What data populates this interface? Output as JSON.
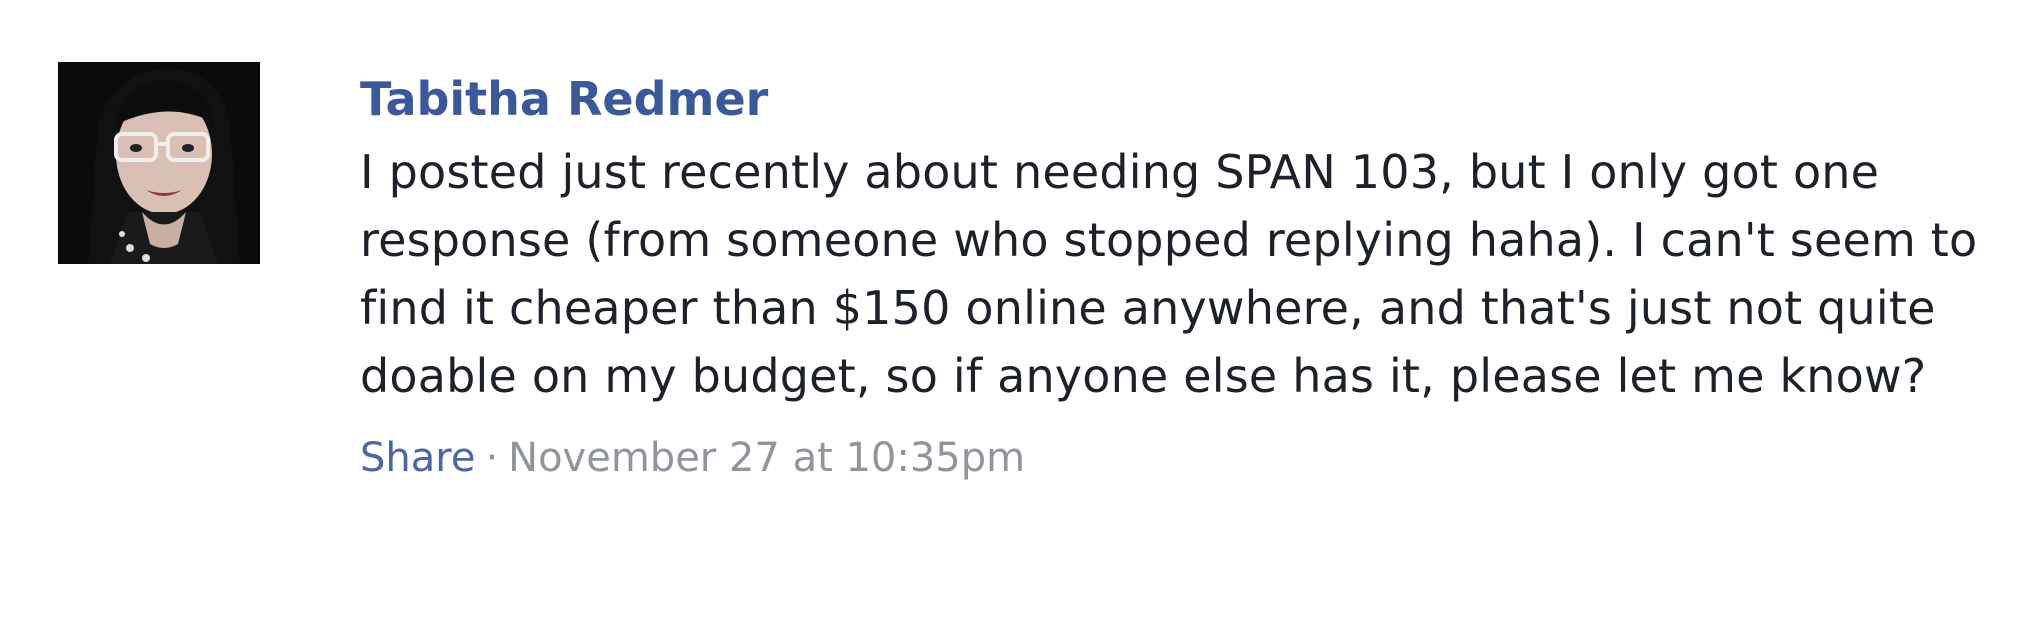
{
  "post": {
    "author": "Tabitha Redmer",
    "message": "I posted just recently about needing SPAN 103, but I only got one response (from someone who stopped replying haha). I can't seem to find it cheaper than $150 online anywhere, and that's just not quite doable on my budget, so if anyone else has it, please let me know?",
    "share_label": "Share",
    "separator": "·",
    "timestamp": "November 27 at 10:35pm"
  },
  "colors": {
    "author_link": "#3b5998",
    "share_link": "#4b67a1",
    "meta_text": "#90949c",
    "body_text": "#1d2129"
  }
}
